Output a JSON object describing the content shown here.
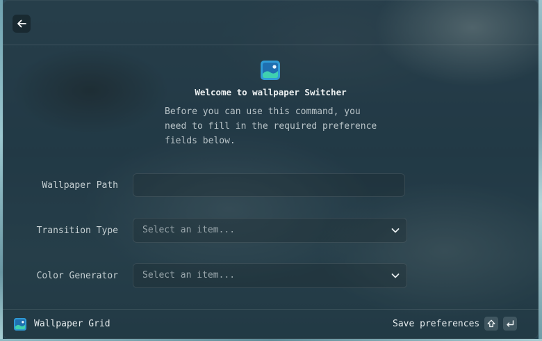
{
  "header": {
    "back_icon": "arrow-left-icon"
  },
  "onboarding": {
    "extension_icon": "wallpaper-image-icon",
    "title": "Welcome to wallpaper Switcher",
    "description": "Before you can use this command, you\nneed to fill in the required preference\nfields below."
  },
  "form": {
    "wallpaper_path": {
      "label": "Wallpaper Path",
      "value": "",
      "placeholder": ""
    },
    "transition_type": {
      "label": "Transition Type",
      "placeholder": "Select an item..."
    },
    "color_generator": {
      "label": "Color Generator",
      "placeholder": "Select an item..."
    }
  },
  "footer": {
    "command_icon": "wallpaper-image-icon",
    "command_title": "Wallpaper Grid",
    "action_label": "Save preferences",
    "shortcut_keys": [
      "shift-icon",
      "enter-icon"
    ]
  },
  "colors": {
    "accent": "#2f9bd6",
    "icon_teal": "#3fd0b0"
  }
}
